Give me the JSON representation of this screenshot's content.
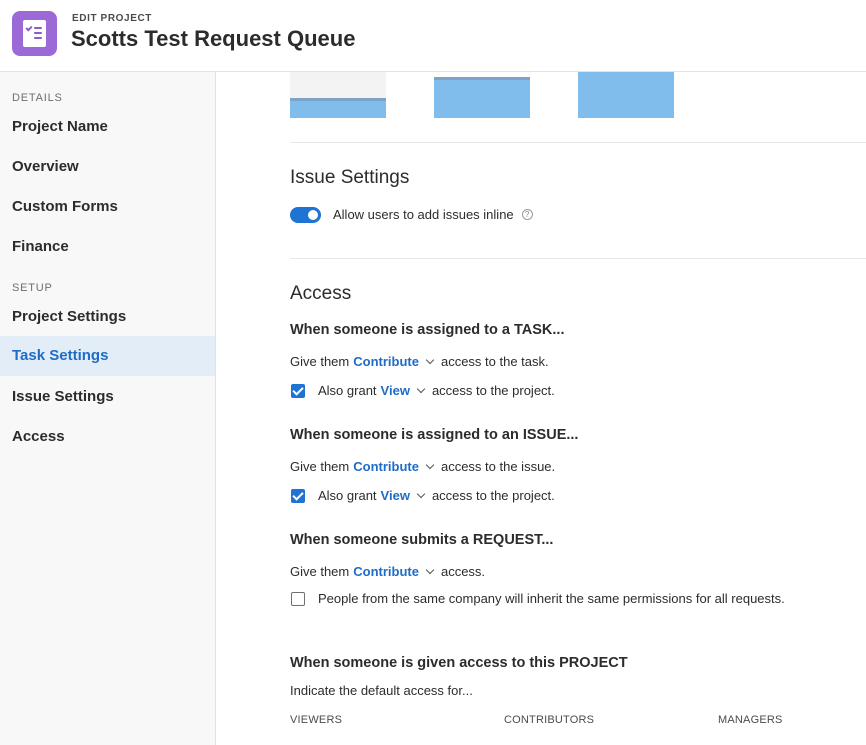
{
  "header": {
    "eyebrow": "EDIT PROJECT",
    "title": "Scotts Test Request Queue",
    "icon": "checklist-document-icon",
    "icon_color": "#9b6ad6"
  },
  "sidebar": {
    "details_label": "DETAILS",
    "setup_label": "SETUP",
    "items": [
      {
        "label": "Project Name"
      },
      {
        "label": "Overview"
      },
      {
        "label": "Custom Forms"
      },
      {
        "label": "Finance"
      },
      {
        "label": "Project Settings"
      },
      {
        "label": "Task Settings",
        "active": true
      },
      {
        "label": "Issue Settings"
      },
      {
        "label": "Access"
      }
    ],
    "active_color": "#1f6cc7",
    "active_bg": "#e2edf8"
  },
  "issue_settings": {
    "title": "Issue Settings",
    "toggle_label": "Allow users to add issues inline",
    "toggle_on": true,
    "help_glyph": "?"
  },
  "access": {
    "title": "Access",
    "task": {
      "heading": "When someone is assigned to a TASK...",
      "give_prefix": "Give them",
      "level": "Contribute",
      "give_suffix": "access to the task.",
      "grant_checked": true,
      "grant_prefix": "Also grant",
      "grant_level": "View",
      "grant_suffix": "access to the project."
    },
    "issue": {
      "heading": "When someone is assigned to an ISSUE...",
      "give_prefix": "Give them",
      "level": "Contribute",
      "give_suffix": "access to the issue.",
      "grant_checked": true,
      "grant_prefix": "Also grant",
      "grant_level": "View",
      "grant_suffix": "access to the project."
    },
    "request": {
      "heading": "When someone submits a REQUEST...",
      "give_prefix": "Give them",
      "level": "Contribute",
      "give_suffix": "access.",
      "inherit_checked": false,
      "inherit_label": "People from the same company will inherit the same permissions for all requests."
    },
    "project": {
      "heading": "When someone is given access to this PROJECT",
      "subtext": "Indicate the default access for...",
      "columns": [
        "VIEWERS",
        "CONTRIBUTORS",
        "MANAGERS"
      ]
    }
  },
  "colors": {
    "link": "#1f6cc7",
    "toggle": "#1f73d2",
    "thumbnail": "#80bdec"
  }
}
